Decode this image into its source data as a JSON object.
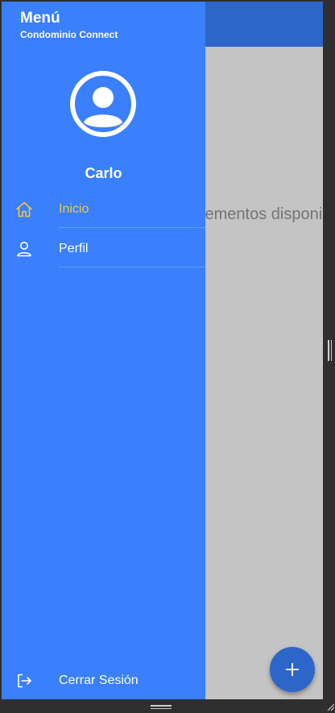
{
  "drawer": {
    "title": "Menú",
    "subtitle": "Condominio Connect",
    "user_name": "Carlo",
    "background_color": "#3a7ffb",
    "items": [
      {
        "label": "Inicio",
        "icon": "home-icon",
        "active": true
      },
      {
        "label": "Perfil",
        "icon": "person-icon",
        "active": false
      }
    ],
    "logout": {
      "label": "Cerrar Sesión",
      "icon": "logout-icon"
    }
  },
  "main": {
    "empty_message": "No hay elementos disponibles",
    "appbar_color": "#2c66c8",
    "fab_icon": "plus-icon"
  },
  "colors": {
    "active_item": "#f5c542",
    "scrim": "#c4c4c4"
  }
}
